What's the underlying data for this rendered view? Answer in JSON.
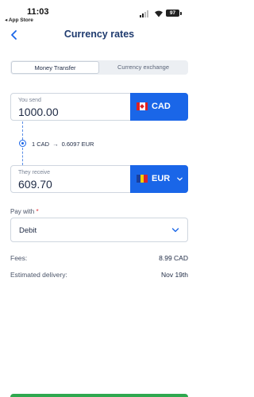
{
  "status_bar": {
    "time": "11:03",
    "back_app": "◂ App Store",
    "battery": "97"
  },
  "header": {
    "title": "Currency rates",
    "back_icon": "chevron-left-icon"
  },
  "tabs": [
    {
      "label": "Money Transfer",
      "active": true
    },
    {
      "label": "Currency exchange",
      "active": false
    }
  ],
  "send": {
    "label": "You send",
    "amount": "1000.00",
    "currency": "CAD",
    "flag": "canada-flag-icon"
  },
  "rate": {
    "from": "1 CAD",
    "arrow": "→",
    "to": "0.6097 EUR"
  },
  "receive": {
    "label": "They receive",
    "amount": "609.70",
    "currency": "EUR",
    "flag": "romania-flag-icon"
  },
  "pay_with": {
    "label": "Pay with",
    "required_mark": "*",
    "value": "Debit"
  },
  "summary": {
    "fees_label": "Fees:",
    "fees_value": "8.99 CAD",
    "delivery_label": "Estimated delivery:",
    "delivery_value": "Nov 19th"
  },
  "colors": {
    "accent": "#1a66e8",
    "title": "#1e3a6e",
    "cta": "#2fa84f"
  }
}
